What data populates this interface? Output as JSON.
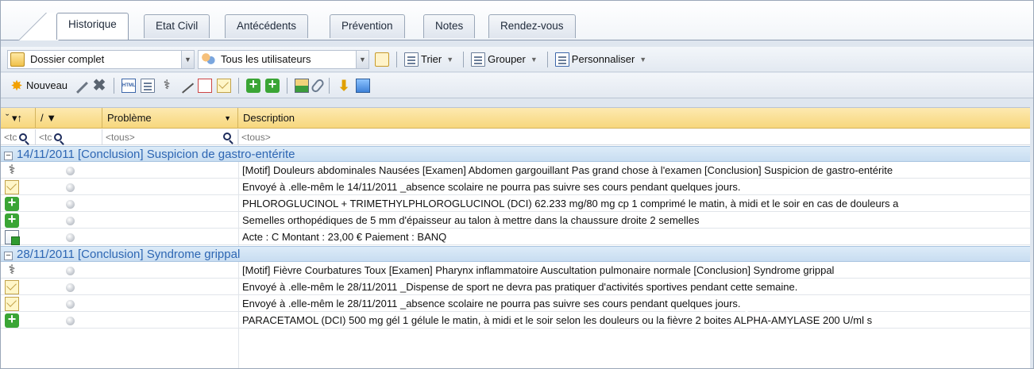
{
  "tabs": [
    "Historique",
    "Etat Civil",
    "Antécédents",
    "Prévention",
    "Notes",
    "Rendez-vous"
  ],
  "active_tab": "Historique",
  "toolbar": {
    "dossier_combo": "Dossier complet",
    "users_combo": "Tous les utilisateurs",
    "sort_label": "Trier",
    "group_label": "Grouper",
    "customize_label": "Personnaliser",
    "new_label": "Nouveau"
  },
  "grid": {
    "headers": {
      "col1": "ˇ",
      "col2": "/",
      "problem": "Problème",
      "description": "Description"
    },
    "filters": {
      "col1": "<tc",
      "col2": "<tc",
      "problem": "<tous>",
      "description": "<tous>"
    },
    "groups": [
      {
        "label": "14/11/2011  [Conclusion] Suspicion de gastro-entérite",
        "rows": [
          {
            "icon": "stethoscope-icon",
            "description": "[Motif] Douleurs abdominales  Nausées [Examen] Abdomen gargouillant  Pas grand chose à l'examen [Conclusion] Suspicion de gastro-entérite"
          },
          {
            "icon": "letter-icon",
            "description": "Envoyé à  .elle-mêm le 14/11/2011 _absence scolaire    ne pourra pas suivre ses cours pendant quelques jours."
          },
          {
            "icon": "prescription-icon",
            "description": "PHLOROGLUCINOL + TRIMETHYLPHLOROGLUCINOL (DCI) 62.233 mg/80 mg cp  1 comprimé le matin, à midi et le soir  en cas de douleurs a"
          },
          {
            "icon": "prescription-icon",
            "description": "Semelles orthopédiques de 5 mm d'épaisseur au talon  à mettre dans la chaussure droite  2 semelles"
          },
          {
            "icon": "billing-icon",
            "description": "Acte : C  Montant : 23,00 € Paiement : BANQ"
          }
        ]
      },
      {
        "label": "28/11/2011  [Conclusion] Syndrome grippal",
        "rows": [
          {
            "icon": "stethoscope-icon",
            "description": "[Motif] Fièvre  Courbatures  Toux [Examen] Pharynx inflammatoire  Auscultation pulmonaire normale [Conclusion] Syndrome grippal"
          },
          {
            "icon": "letter-icon",
            "description": "Envoyé à  .elle-mêm le 28/11/2011 _Dispense de sport      ne devra pas pratiquer d'activités sportives pendant cette semaine."
          },
          {
            "icon": "letter-icon",
            "description": "Envoyé à  .elle-mêm le 28/11/2011 _absence scolaire    ne pourra pas suivre ses cours pendant quelques jours."
          },
          {
            "icon": "prescription-icon",
            "description": "PARACETAMOL (DCI) 500 mg gél  1 gélule le matin, à midi et le soir selon les douleurs ou la fièvre           2 boites  ALPHA-AMYLASE 200 U/ml s"
          }
        ]
      }
    ]
  }
}
